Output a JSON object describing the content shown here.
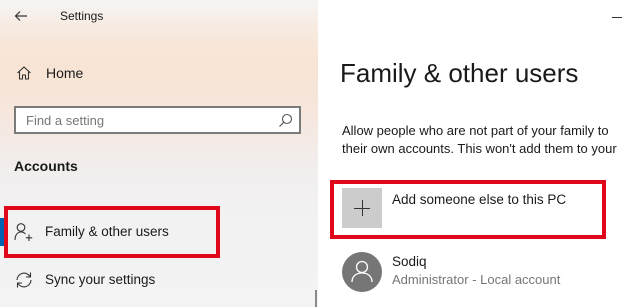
{
  "window": {
    "title": "Settings"
  },
  "sidebar": {
    "home_label": "Home",
    "search": {
      "placeholder": "Find a setting"
    },
    "section_title": "Accounts",
    "items": [
      {
        "label": "Family & other users",
        "icon": "person-add-icon",
        "selected": true
      },
      {
        "label": "Sync your settings",
        "icon": "sync-icon",
        "selected": false
      }
    ]
  },
  "main": {
    "title": "Family & other users",
    "description_line1": "Allow people who are not part of your family to",
    "description_line2": "their own accounts. This won't add them to your",
    "add_user_label": "Add someone else to this PC",
    "users": [
      {
        "name": "Sodiq",
        "role": "Administrator - Local account"
      }
    ]
  },
  "colors": {
    "accent": "#0063b1",
    "highlight_box": "#e0071b",
    "avatar": "#767676"
  }
}
